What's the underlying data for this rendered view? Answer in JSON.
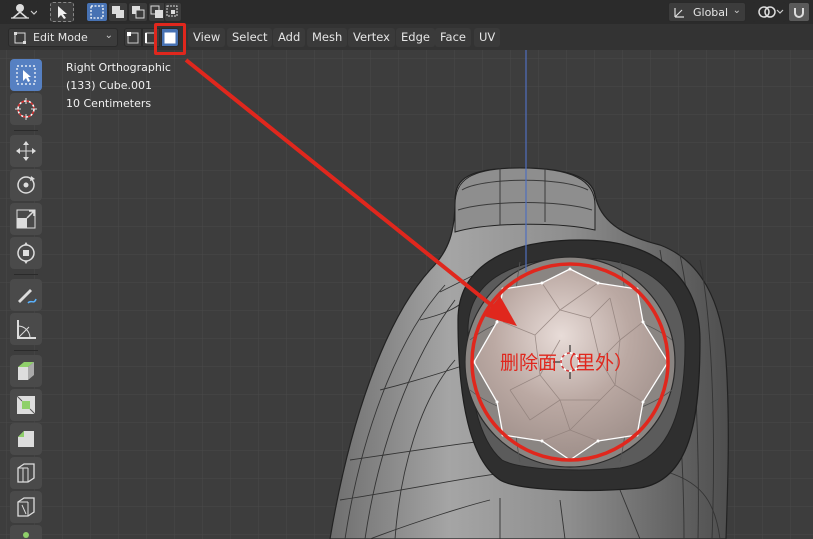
{
  "app": {
    "name": "Blender 3D Viewport"
  },
  "topbar": {
    "transform_orientation": "Global",
    "select_mode_buttons": [
      "select-box",
      "select-extend",
      "select-subtract",
      "select-invert",
      "select-intersect"
    ]
  },
  "header": {
    "mode": "Edit Mode",
    "select_modes": [
      "vertex",
      "edge",
      "face"
    ],
    "active_select_mode": "face",
    "menus": [
      "View",
      "Select",
      "Add",
      "Mesh",
      "Vertex",
      "Edge",
      "Face",
      "UV"
    ]
  },
  "viewport_info": {
    "view_name": "Right Orthographic",
    "object": "(133) Cube.001",
    "grid_scale": "10 Centimeters"
  },
  "annotation": {
    "label": "删除面（里外）",
    "color": "#e0271d"
  },
  "toolbar": {
    "tools": [
      "select-box-icon",
      "cursor-icon",
      "move-icon",
      "rotate-icon",
      "scale-icon",
      "transform-icon",
      "annotate-icon",
      "measure-icon",
      "extrude-icon",
      "inset-icon",
      "bevel-icon",
      "loop-cut-icon",
      "knife-icon"
    ],
    "active_tool": "select-box-icon"
  },
  "colors": {
    "grid_bg": "#3d3d3d",
    "grid_line": "#4a4a4a",
    "axis_blue": "#4f6fbd",
    "accent": "#4772b3",
    "annotation_red": "#e0271d",
    "mesh_gray": "#8a8a8a",
    "selected_face": "#b8a8a2"
  }
}
